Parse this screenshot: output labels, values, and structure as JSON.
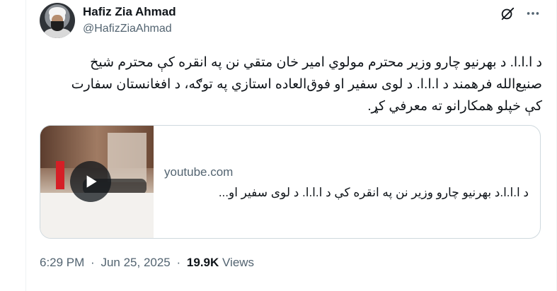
{
  "author": {
    "display_name": "Hafiz Zia Ahmad",
    "handle": "@HafizZiaAhmad"
  },
  "icons": {
    "grok": "grok-icon",
    "more": "more-dots-icon",
    "play": "play-icon"
  },
  "tweet": {
    "text": "د ا.ا.ا. د بهرنيو چارو وزير محترم مولوي امير خان متقي نن په انقره کې محترم شيخ صنيع‌الله فرهمند د ا.ا.ا. د لوی سفير او فوق‌العاده استازي په توګه، د افغانستان سفارت کې خپلو همکارانو ته معرفي کړ."
  },
  "card": {
    "domain": "youtube.com",
    "title": "د ا.ا.ا.د بهرنيو چارو وزير نن په انقره کې د ا.ا.ا. د لوی سفير او..."
  },
  "meta": {
    "time": "6:29 PM",
    "separator": "·",
    "date": "Jun 25, 2025",
    "views_count": "19.9K",
    "views_label": "Views"
  },
  "colors": {
    "text": "#0f1419",
    "secondary": "#536471",
    "border": "#cfd9de"
  }
}
